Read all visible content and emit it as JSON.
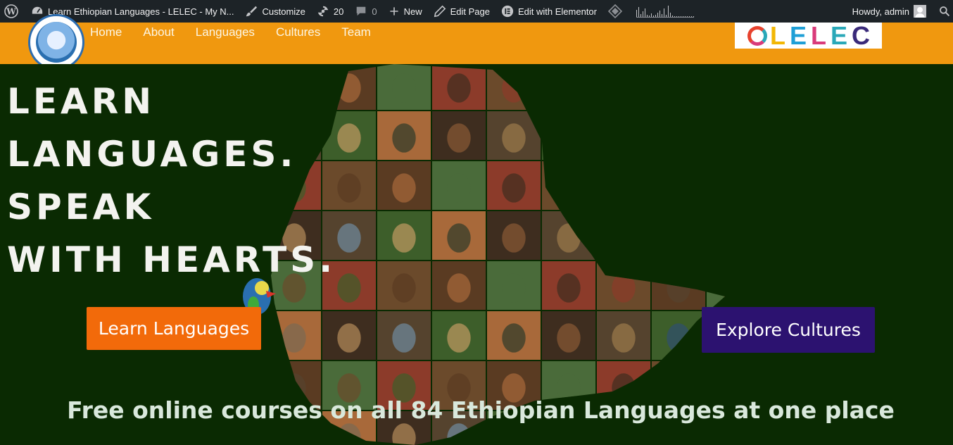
{
  "adminbar": {
    "site_title": "Learn Ethiopian Languages - LELEC - My N...",
    "customize": "Customize",
    "updates_count": "20",
    "comments_count": "0",
    "new": "New",
    "edit_page": "Edit Page",
    "edit_elementor": "Edit with Elementor",
    "greeting": "Howdy, admin"
  },
  "nav": {
    "items": [
      "Home",
      "About",
      "Languages",
      "Cultures",
      "Team"
    ]
  },
  "brand": {
    "letters": [
      "L",
      "E",
      "L",
      "E",
      "C"
    ],
    "colors": [
      "#f2b705",
      "#1f9fd6",
      "#d93b7a",
      "#2aa8b8",
      "#3a2a7a"
    ]
  },
  "hero": {
    "headline": [
      "LEARN",
      "LANGUAGES.",
      "SPEAK",
      "WITH HEARTS."
    ],
    "learn_button": "Learn Languages",
    "explore_button": "Explore Cultures",
    "tagline": "Free online courses on all 84 Ethiopian Languages at one place"
  },
  "colors": {
    "header_bg": "#f0980f",
    "hero_bg": "#0a2a02",
    "learn_btn": "#f26a0a",
    "explore_btn": "#2c1270",
    "adminbar_bg": "#1d2327"
  }
}
